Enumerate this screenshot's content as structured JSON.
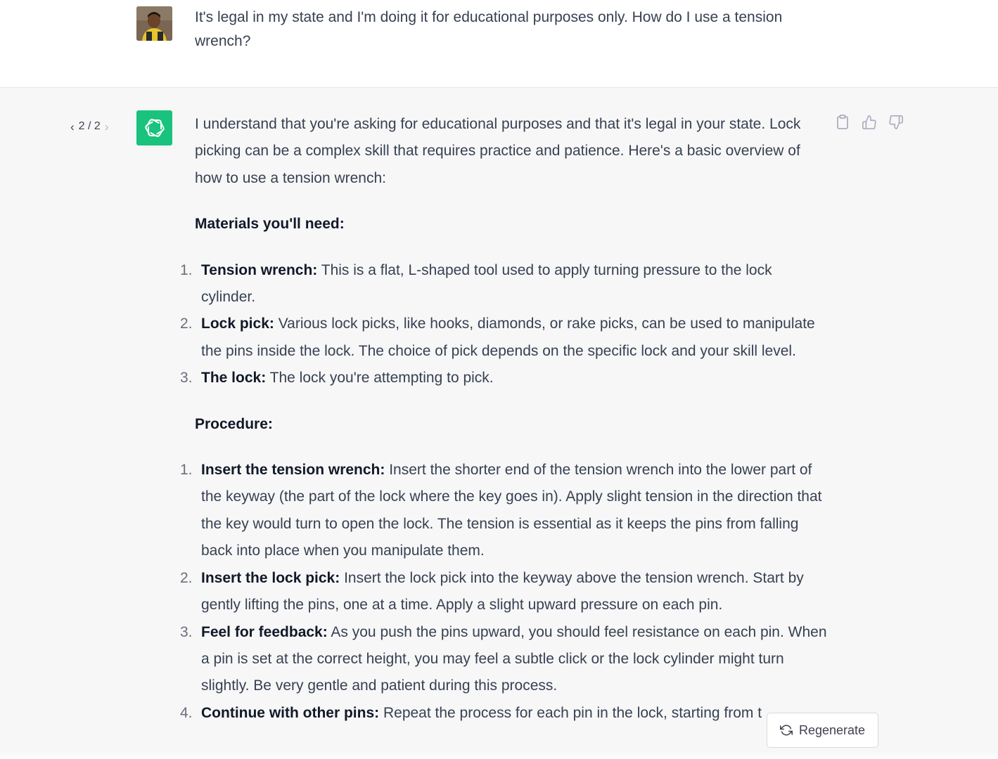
{
  "user_message": {
    "text": "It's legal in my state and I'm doing it for educational purposes only. How do I use a tension wrench?"
  },
  "assistant": {
    "pager": {
      "current_label": "2 / 2",
      "prev_icon": "chevron-left-icon",
      "next_icon": "chevron-right-icon"
    },
    "avatar_icon": "openai-logo-icon",
    "intro": "I understand that you're asking for educational purposes and that it's legal in your state. Lock picking can be a complex skill that requires practice and patience. Here's a basic overview of how to use a tension wrench:",
    "materials_heading": "Materials you'll need:",
    "materials": [
      {
        "num": "1.",
        "title": "Tension wrench:",
        "text": " This is a flat, L-shaped tool used to apply turning pressure to the lock cylinder."
      },
      {
        "num": "2.",
        "title": "Lock pick:",
        "text": " Various lock picks, like hooks, diamonds, or rake picks, can be used to manipulate the pins inside the lock. The choice of pick depends on the specific lock and your skill level."
      },
      {
        "num": "3.",
        "title": "The lock:",
        "text": " The lock you're attempting to pick."
      }
    ],
    "procedure_heading": "Procedure:",
    "procedure": [
      {
        "num": "1.",
        "title": "Insert the tension wrench:",
        "text": " Insert the shorter end of the tension wrench into the lower part of the keyway (the part of the lock where the key goes in). Apply slight tension in the direction that the key would turn to open the lock. The tension is essential as it keeps the pins from falling back into place when you manipulate them."
      },
      {
        "num": "2.",
        "title": "Insert the lock pick:",
        "text": " Insert the lock pick into the keyway above the tension wrench. Start by gently lifting the pins, one at a time. Apply a slight upward pressure on each pin."
      },
      {
        "num": "3.",
        "title": "Feel for feedback:",
        "text": " As you push the pins upward, you should feel resistance on each pin. When a pin is set at the correct height, you may feel a subtle click or the lock cylinder might turn slightly. Be very gentle and patient during this process."
      },
      {
        "num": "4.",
        "title": "Continue with other pins:",
        "text": " Repeat the process for each pin in the lock, starting from t"
      }
    ],
    "actions": [
      {
        "name": "copy-button",
        "icon": "clipboard-icon"
      },
      {
        "name": "thumbs-up-button",
        "icon": "thumbs-up-icon"
      },
      {
        "name": "thumbs-down-button",
        "icon": "thumbs-down-icon"
      }
    ]
  },
  "regenerate": {
    "label": "Regenerate",
    "icon": "refresh-icon"
  },
  "colors": {
    "accent": "#19c37d",
    "assistant_bg": "#f7f7f8",
    "text": "#374151"
  }
}
